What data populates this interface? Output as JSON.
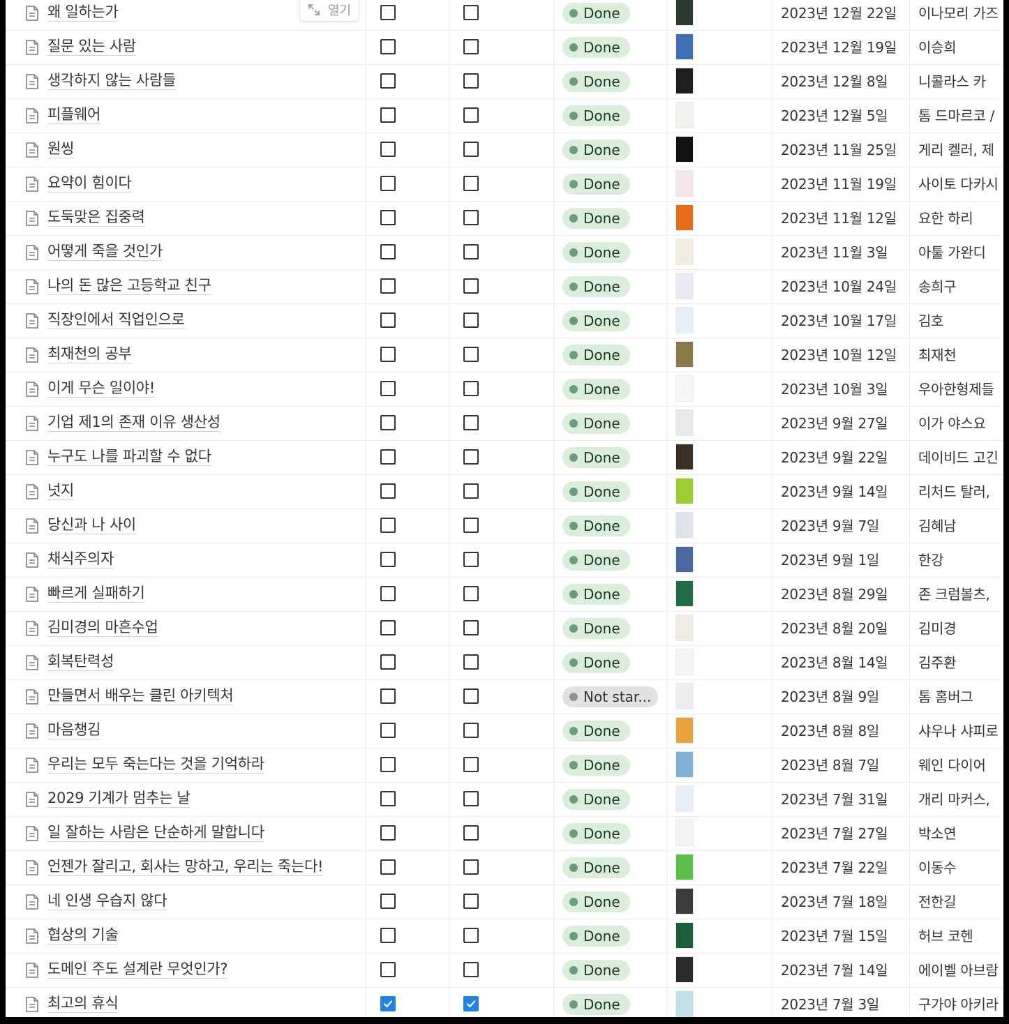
{
  "open_button_label": "열기",
  "colors": {
    "checkbox_checked": "#2383e2",
    "done_bg": "#dbeddb",
    "done_dot": "#6c9b7d",
    "not_started_bg": "#e3e2e0",
    "not_started_dot": "#91918e"
  },
  "rows": [
    {
      "title": "왜 일하는가",
      "check1": false,
      "check2": false,
      "status": "Done",
      "cover_color": "#2b3a2e",
      "date": "2023년 12월 22일",
      "author": "이나모리 가즈"
    },
    {
      "title": "질문 있는 사람",
      "check1": false,
      "check2": false,
      "status": "Done",
      "cover_color": "#3f6fb5",
      "date": "2023년 12월 19일",
      "author": "이승희"
    },
    {
      "title": "생각하지 않는 사람들",
      "check1": false,
      "check2": false,
      "status": "Done",
      "cover_color": "#1e1e1e",
      "date": "2023년 12월 8일",
      "author": "니콜라스 카"
    },
    {
      "title": "피플웨어",
      "check1": false,
      "check2": false,
      "status": "Done",
      "cover_color": "#f3f1ec",
      "date": "2023년 12월 5일",
      "author": "톰 드마르코 /"
    },
    {
      "title": "원씽",
      "check1": false,
      "check2": false,
      "status": "Done",
      "cover_color": "#111111",
      "date": "2023년 11월 25일",
      "author": "게리 켈러, 제"
    },
    {
      "title": "요약이 힘이다",
      "check1": false,
      "check2": false,
      "status": "Done",
      "cover_color": "#f4e6ec",
      "date": "2023년 11월 19일",
      "author": "사이토 다카시"
    },
    {
      "title": "도둑맞은 집중력",
      "check1": false,
      "check2": false,
      "status": "Done",
      "cover_color": "#e56a1a",
      "date": "2023년 11월 12일",
      "author": "요한 하리"
    },
    {
      "title": "어떻게 죽을 것인가",
      "check1": false,
      "check2": false,
      "status": "Done",
      "cover_color": "#f2efe1",
      "date": "2023년 11월 3일",
      "author": "아툴 가완디"
    },
    {
      "title": "나의 돈 많은 고등학교 친구",
      "check1": false,
      "check2": false,
      "status": "Done",
      "cover_color": "#e8ecf2",
      "date": "2023년 10월 24일",
      "author": "송희구"
    },
    {
      "title": "직장인에서 직업인으로",
      "check1": false,
      "check2": false,
      "status": "Done",
      "cover_color": "#e6eef5",
      "date": "2023년 10월 17일",
      "author": "김호"
    },
    {
      "title": "최재천의 공부",
      "check1": false,
      "check2": false,
      "status": "Done",
      "cover_color": "#8c7a4a",
      "date": "2023년 10월 12일",
      "author": "최재천"
    },
    {
      "title": "이게 무슨 일이야!",
      "check1": false,
      "check2": false,
      "status": "Done",
      "cover_color": "#f7f7f7",
      "date": "2023년 10월 3일",
      "author": "우아한형제들"
    },
    {
      "title": "기업 제1의 존재 이유 생산성",
      "check1": false,
      "check2": false,
      "status": "Done",
      "cover_color": "#e9e9e9",
      "date": "2023년 9월 27일",
      "author": "이가 야스요"
    },
    {
      "title": "누구도 나를 파괴할 수 없다",
      "check1": false,
      "check2": false,
      "status": "Done",
      "cover_color": "#3a2f23",
      "date": "2023년 9월 22일",
      "author": "데이비드 고긴"
    },
    {
      "title": "넛지",
      "check1": false,
      "check2": false,
      "status": "Done",
      "cover_color": "#9acd32",
      "date": "2023년 9월 14일",
      "author": "리처드 탈러, "
    },
    {
      "title": "당신과 나 사이",
      "check1": false,
      "check2": false,
      "status": "Done",
      "cover_color": "#dfe4ea",
      "date": "2023년 9월 7일",
      "author": "김혜남"
    },
    {
      "title": "채식주의자",
      "check1": false,
      "check2": false,
      "status": "Done",
      "cover_color": "#4a6aa0",
      "date": "2023년 9월 1일",
      "author": "한강"
    },
    {
      "title": "빠르게 실패하기",
      "check1": false,
      "check2": false,
      "status": "Done",
      "cover_color": "#1f6b4a",
      "date": "2023년 8월 29일",
      "author": "존 크럼볼츠, "
    },
    {
      "title": "김미경의 마흔수업",
      "check1": false,
      "check2": false,
      "status": "Done",
      "cover_color": "#f0ece3",
      "date": "2023년 8월 20일",
      "author": "김미경"
    },
    {
      "title": "회복탄력성",
      "check1": false,
      "check2": false,
      "status": "Done",
      "cover_color": "#f5f5f5",
      "date": "2023년 8월 14일",
      "author": "김주환"
    },
    {
      "title": "만들면서 배우는 클린 아키텍처",
      "check1": false,
      "check2": false,
      "status": "Not star...",
      "cover_color": "#eeeeee",
      "date": "2023년 8월 9일",
      "author": "톰 홈버그"
    },
    {
      "title": "마음챙김",
      "check1": false,
      "check2": false,
      "status": "Done",
      "cover_color": "#e9a23b",
      "date": "2023년 8월 8일",
      "author": "샤우나 샤피로"
    },
    {
      "title": "우리는 모두 죽는다는 것을 기억하라",
      "check1": false,
      "check2": false,
      "status": "Done",
      "cover_color": "#7fb0d6",
      "date": "2023년 8월 7일",
      "author": "웨인 다이어"
    },
    {
      "title": "2029 기계가 멈추는 날",
      "check1": false,
      "check2": false,
      "status": "Done",
      "cover_color": "#e7eef7",
      "date": "2023년 7월 31일",
      "author": "개리 마커스, "
    },
    {
      "title": "일 잘하는 사람은 단순하게 말합니다",
      "check1": false,
      "check2": false,
      "status": "Done",
      "cover_color": "#f3f3f3",
      "date": "2023년 7월 27일",
      "author": "박소연"
    },
    {
      "title": "언젠가 잘리고, 회사는 망하고, 우리는 죽는다!",
      "check1": false,
      "check2": false,
      "status": "Done",
      "cover_color": "#5bbf4a",
      "date": "2023년 7월 22일",
      "author": "이동수"
    },
    {
      "title": "네 인생 우습지 않다",
      "check1": false,
      "check2": false,
      "status": "Done",
      "cover_color": "#3c3c3c",
      "date": "2023년 7월 18일",
      "author": "전한길"
    },
    {
      "title": "협상의 기술",
      "check1": false,
      "check2": false,
      "status": "Done",
      "cover_color": "#1d5e3a",
      "date": "2023년 7월 15일",
      "author": "허브 코헨"
    },
    {
      "title": "도메인 주도 설계란 무엇인가?",
      "check1": false,
      "check2": false,
      "status": "Done",
      "cover_color": "#2a2a2a",
      "date": "2023년 7월 14일",
      "author": "에이벨 아브람"
    },
    {
      "title": "최고의 휴식",
      "check1": true,
      "check2": true,
      "status": "Done",
      "cover_color": "#bfe0ea",
      "date": "2023년 7월 3일",
      "author": "구가야 아키라"
    }
  ]
}
